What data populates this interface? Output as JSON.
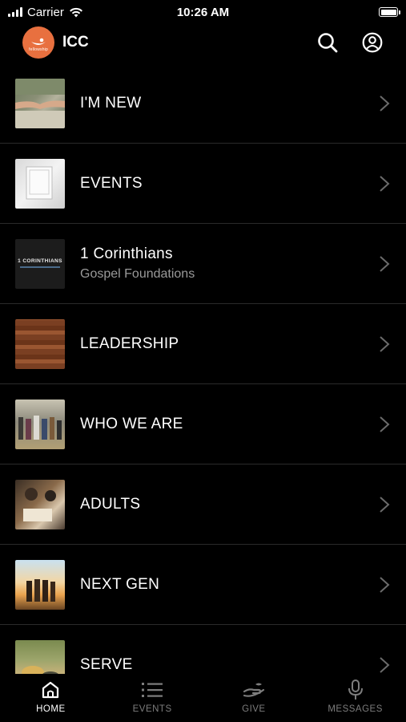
{
  "status_bar": {
    "carrier": "Carrier",
    "time": "10:26 AM"
  },
  "header": {
    "title": "ICC",
    "logo_text": "fellowship",
    "logo_color": "#e8703f"
  },
  "list": {
    "items": [
      {
        "title": "I'M NEW",
        "subtitle": "",
        "thumb": "handshake-photo"
      },
      {
        "title": "EVENTS",
        "subtitle": "",
        "thumb": "paper-photo"
      },
      {
        "title": "1 Corinthians",
        "subtitle": "Gospel Foundations",
        "thumb": "series-art",
        "thumb_text": "1 CORINTHIANS"
      },
      {
        "title": "LEADERSHIP",
        "subtitle": "",
        "thumb": "wood-photo"
      },
      {
        "title": "WHO WE ARE",
        "subtitle": "",
        "thumb": "people-photo"
      },
      {
        "title": "ADULTS",
        "subtitle": "",
        "thumb": "bible-study-photo"
      },
      {
        "title": "NEXT GEN",
        "subtitle": "",
        "thumb": "sunset-group-photo"
      },
      {
        "title": "SERVE",
        "subtitle": "",
        "thumb": "gardening-photo"
      }
    ]
  },
  "tab_bar": {
    "tabs": [
      {
        "label": "HOME",
        "icon": "home-icon",
        "active": true
      },
      {
        "label": "EVENTS",
        "icon": "list-icon",
        "active": false
      },
      {
        "label": "GIVE",
        "icon": "give-hand-icon",
        "active": false
      },
      {
        "label": "MESSAGES",
        "icon": "microphone-icon",
        "active": false
      }
    ]
  },
  "colors": {
    "background": "#000000",
    "accent": "#e8703f",
    "divider": "#2a2a2a",
    "inactive_tab": "#7d7d7d"
  }
}
